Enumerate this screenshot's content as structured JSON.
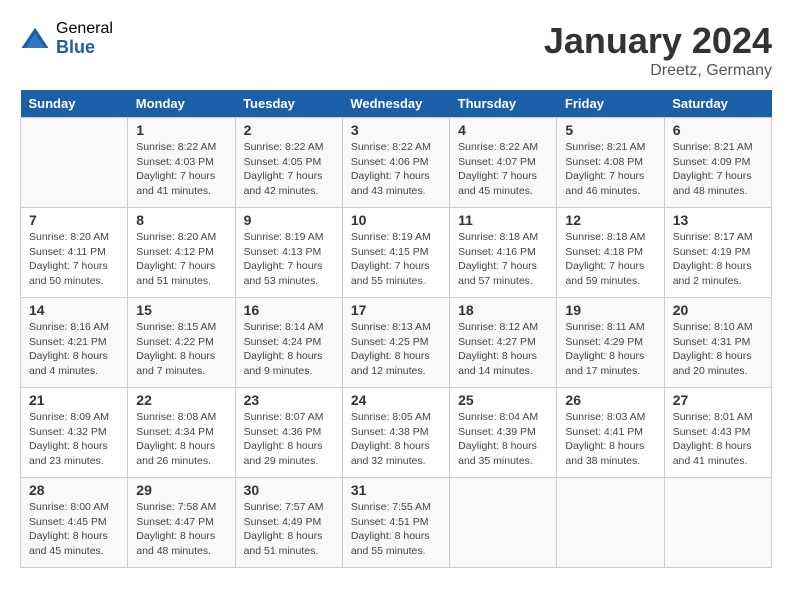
{
  "header": {
    "logo_general": "General",
    "logo_blue": "Blue",
    "month_title": "January 2024",
    "location": "Dreetz, Germany"
  },
  "days_of_week": [
    "Sunday",
    "Monday",
    "Tuesday",
    "Wednesday",
    "Thursday",
    "Friday",
    "Saturday"
  ],
  "weeks": [
    [
      {
        "day": "",
        "info": ""
      },
      {
        "day": "1",
        "info": "Sunrise: 8:22 AM\nSunset: 4:03 PM\nDaylight: 7 hours\nand 41 minutes."
      },
      {
        "day": "2",
        "info": "Sunrise: 8:22 AM\nSunset: 4:05 PM\nDaylight: 7 hours\nand 42 minutes."
      },
      {
        "day": "3",
        "info": "Sunrise: 8:22 AM\nSunset: 4:06 PM\nDaylight: 7 hours\nand 43 minutes."
      },
      {
        "day": "4",
        "info": "Sunrise: 8:22 AM\nSunset: 4:07 PM\nDaylight: 7 hours\nand 45 minutes."
      },
      {
        "day": "5",
        "info": "Sunrise: 8:21 AM\nSunset: 4:08 PM\nDaylight: 7 hours\nand 46 minutes."
      },
      {
        "day": "6",
        "info": "Sunrise: 8:21 AM\nSunset: 4:09 PM\nDaylight: 7 hours\nand 48 minutes."
      }
    ],
    [
      {
        "day": "7",
        "info": "Sunrise: 8:20 AM\nSunset: 4:11 PM\nDaylight: 7 hours\nand 50 minutes."
      },
      {
        "day": "8",
        "info": "Sunrise: 8:20 AM\nSunset: 4:12 PM\nDaylight: 7 hours\nand 51 minutes."
      },
      {
        "day": "9",
        "info": "Sunrise: 8:19 AM\nSunset: 4:13 PM\nDaylight: 7 hours\nand 53 minutes."
      },
      {
        "day": "10",
        "info": "Sunrise: 8:19 AM\nSunset: 4:15 PM\nDaylight: 7 hours\nand 55 minutes."
      },
      {
        "day": "11",
        "info": "Sunrise: 8:18 AM\nSunset: 4:16 PM\nDaylight: 7 hours\nand 57 minutes."
      },
      {
        "day": "12",
        "info": "Sunrise: 8:18 AM\nSunset: 4:18 PM\nDaylight: 7 hours\nand 59 minutes."
      },
      {
        "day": "13",
        "info": "Sunrise: 8:17 AM\nSunset: 4:19 PM\nDaylight: 8 hours\nand 2 minutes."
      }
    ],
    [
      {
        "day": "14",
        "info": "Sunrise: 8:16 AM\nSunset: 4:21 PM\nDaylight: 8 hours\nand 4 minutes."
      },
      {
        "day": "15",
        "info": "Sunrise: 8:15 AM\nSunset: 4:22 PM\nDaylight: 8 hours\nand 7 minutes."
      },
      {
        "day": "16",
        "info": "Sunrise: 8:14 AM\nSunset: 4:24 PM\nDaylight: 8 hours\nand 9 minutes."
      },
      {
        "day": "17",
        "info": "Sunrise: 8:13 AM\nSunset: 4:25 PM\nDaylight: 8 hours\nand 12 minutes."
      },
      {
        "day": "18",
        "info": "Sunrise: 8:12 AM\nSunset: 4:27 PM\nDaylight: 8 hours\nand 14 minutes."
      },
      {
        "day": "19",
        "info": "Sunrise: 8:11 AM\nSunset: 4:29 PM\nDaylight: 8 hours\nand 17 minutes."
      },
      {
        "day": "20",
        "info": "Sunrise: 8:10 AM\nSunset: 4:31 PM\nDaylight: 8 hours\nand 20 minutes."
      }
    ],
    [
      {
        "day": "21",
        "info": "Sunrise: 8:09 AM\nSunset: 4:32 PM\nDaylight: 8 hours\nand 23 minutes."
      },
      {
        "day": "22",
        "info": "Sunrise: 8:08 AM\nSunset: 4:34 PM\nDaylight: 8 hours\nand 26 minutes."
      },
      {
        "day": "23",
        "info": "Sunrise: 8:07 AM\nSunset: 4:36 PM\nDaylight: 8 hours\nand 29 minutes."
      },
      {
        "day": "24",
        "info": "Sunrise: 8:05 AM\nSunset: 4:38 PM\nDaylight: 8 hours\nand 32 minutes."
      },
      {
        "day": "25",
        "info": "Sunrise: 8:04 AM\nSunset: 4:39 PM\nDaylight: 8 hours\nand 35 minutes."
      },
      {
        "day": "26",
        "info": "Sunrise: 8:03 AM\nSunset: 4:41 PM\nDaylight: 8 hours\nand 38 minutes."
      },
      {
        "day": "27",
        "info": "Sunrise: 8:01 AM\nSunset: 4:43 PM\nDaylight: 8 hours\nand 41 minutes."
      }
    ],
    [
      {
        "day": "28",
        "info": "Sunrise: 8:00 AM\nSunset: 4:45 PM\nDaylight: 8 hours\nand 45 minutes."
      },
      {
        "day": "29",
        "info": "Sunrise: 7:58 AM\nSunset: 4:47 PM\nDaylight: 8 hours\nand 48 minutes."
      },
      {
        "day": "30",
        "info": "Sunrise: 7:57 AM\nSunset: 4:49 PM\nDaylight: 8 hours\nand 51 minutes."
      },
      {
        "day": "31",
        "info": "Sunrise: 7:55 AM\nSunset: 4:51 PM\nDaylight: 8 hours\nand 55 minutes."
      },
      {
        "day": "",
        "info": ""
      },
      {
        "day": "",
        "info": ""
      },
      {
        "day": "",
        "info": ""
      }
    ]
  ]
}
